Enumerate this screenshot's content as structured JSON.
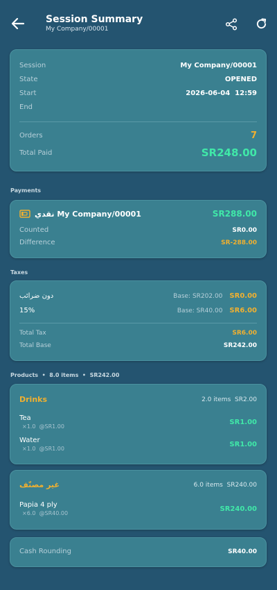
{
  "header": {
    "title": "Session Summary",
    "subtitle": "My Company/00001"
  },
  "session": {
    "session_label": "Session",
    "session_value": "My Company/00001",
    "state_label": "State",
    "state_value": "OPENED",
    "start_label": "Start",
    "start_value": "2026-06-04  12:59",
    "end_label": "End",
    "end_value": "",
    "orders_label": "Orders",
    "orders_value": "7",
    "total_paid_label": "Total Paid",
    "total_paid_value": "SR248.00"
  },
  "payments": {
    "section_label": "Payments",
    "method_name": "نقدي My Company/00001",
    "method_amount": "SR288.00",
    "counted_label": "Counted",
    "counted_value": "SR0.00",
    "difference_label": "Difference",
    "difference_value": "SR-288.00"
  },
  "taxes": {
    "section_label": "Taxes",
    "rows": [
      {
        "name": "دون ضرائب",
        "base": "Base: SR202.00",
        "amount": "SR0.00"
      },
      {
        "name": "15%",
        "base": "Base: SR40.00",
        "amount": "SR6.00"
      }
    ],
    "total_tax_label": "Total Tax",
    "total_tax_value": "SR6.00",
    "total_base_label": "Total Base",
    "total_base_value": "SR242.00"
  },
  "products": {
    "section_label": "Products  •  8.0 items  •  SR242.00",
    "categories": [
      {
        "name": "Drinks",
        "summary": "2.0 items  SR2.00",
        "items": [
          {
            "name": "Tea",
            "detail": "×1.0  @SR1.00",
            "total": "SR1.00"
          },
          {
            "name": "Water",
            "detail": "×1.0  @SR1.00",
            "total": "SR1.00"
          }
        ]
      },
      {
        "name": "غير مصنّف",
        "summary": "6.0 items  SR240.00",
        "items": [
          {
            "name": "Papia 4 ply",
            "detail": "×6.0  @SR40.00",
            "total": "SR240.00"
          }
        ]
      }
    ]
  },
  "cash_rounding": {
    "label": "Cash Rounding",
    "value": "SR40.00"
  },
  "icons": {
    "back": "arrow-left-icon",
    "share": "share-icon",
    "refresh": "refresh-icon",
    "cash": "cash-icon"
  },
  "colors": {
    "background": "#245470",
    "card": "#3a8090",
    "accent_orange": "#f0b030",
    "accent_green": "#40e8a8"
  }
}
